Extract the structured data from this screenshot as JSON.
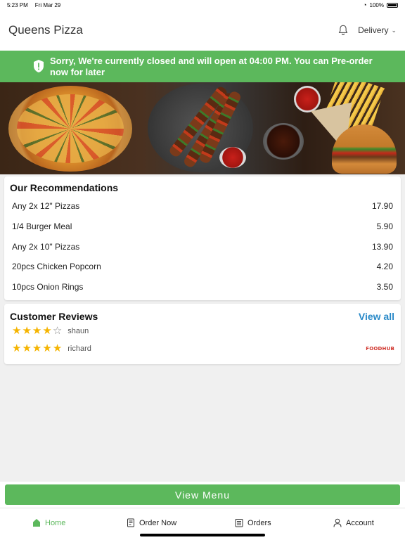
{
  "status_bar": {
    "time": "5:23 PM",
    "date": "Fri Mar 29",
    "battery": "100%"
  },
  "header": {
    "store_name": "Queens Pizza",
    "delivery_label": "Delivery"
  },
  "banner": {
    "message": "Sorry, We're currently closed and will open at 04:00 PM. You can Pre-order now for later"
  },
  "recommendations": {
    "title": "Our Recommendations",
    "items": [
      {
        "name": "Any 2x 12\" Pizzas",
        "price": "17.90"
      },
      {
        "name": "1/4 Burger Meal",
        "price": "5.90"
      },
      {
        "name": "Any 2x 10\" Pizzas",
        "price": "13.90"
      },
      {
        "name": "20pcs Chicken Popcorn",
        "price": "4.20"
      },
      {
        "name": "10pcs Onion Rings",
        "price": "3.50"
      }
    ]
  },
  "reviews": {
    "title": "Customer Reviews",
    "view_all": "View all",
    "items": [
      {
        "name": "shaun",
        "rating": 4
      },
      {
        "name": "richard",
        "rating": 5
      }
    ],
    "logo_text": "FOODHUB"
  },
  "view_menu_label": "View Menu",
  "tabs": [
    {
      "label": "Home",
      "icon": "home-icon",
      "active": true
    },
    {
      "label": "Order Now",
      "icon": "order-icon",
      "active": false
    },
    {
      "label": "Orders",
      "icon": "orders-icon",
      "active": false
    },
    {
      "label": "Account",
      "icon": "account-icon",
      "active": false
    }
  ],
  "colors": {
    "accent": "#5cb85c",
    "link": "#2a8ac8",
    "star": "#f5b400"
  }
}
